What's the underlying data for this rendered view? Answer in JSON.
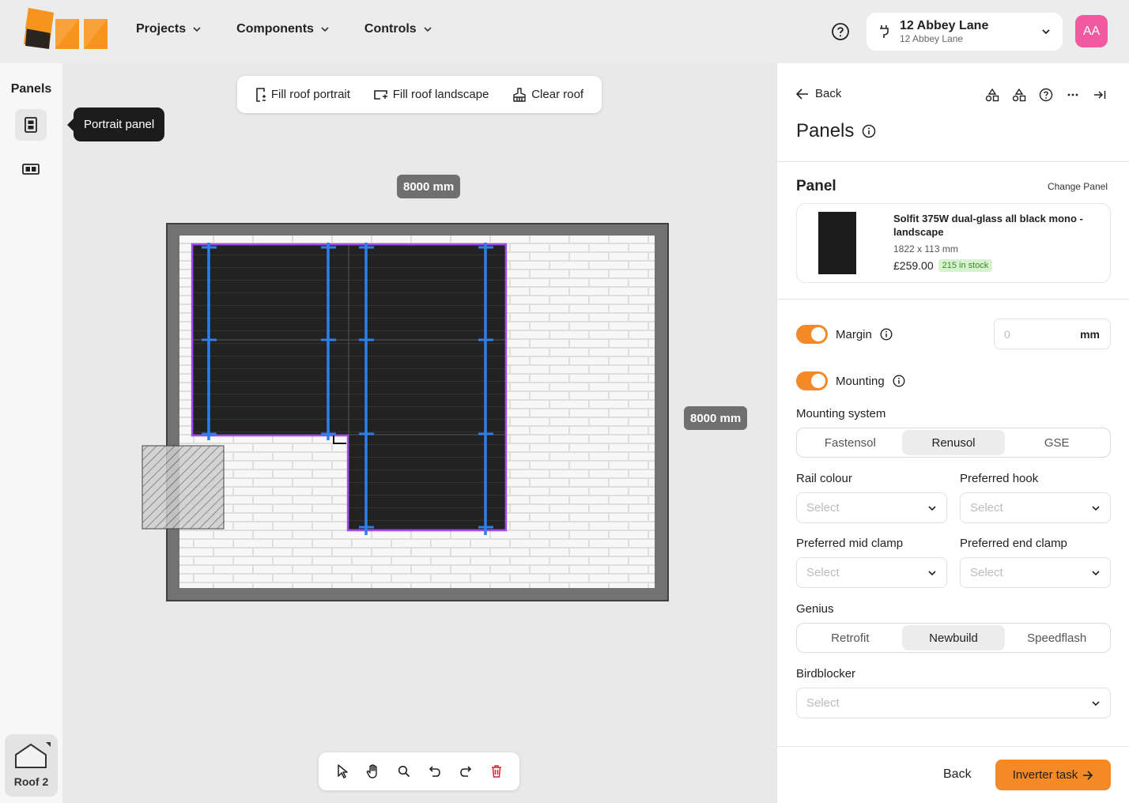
{
  "header": {
    "nav": [
      {
        "label": "Projects"
      },
      {
        "label": "Components"
      },
      {
        "label": "Controls"
      }
    ],
    "address": {
      "title": "12 Abbey Lane",
      "subtitle": "12 Abbey Lane"
    },
    "avatar_initials": "AA"
  },
  "left_rail": {
    "title": "Panels",
    "tooltip": "Portrait panel",
    "roof_label": "Roof 2"
  },
  "canvas": {
    "fill_actions": [
      {
        "label": "Fill roof portrait",
        "icon": "portrait-fill-icon"
      },
      {
        "label": "Fill roof landscape",
        "icon": "landscape-fill-icon"
      },
      {
        "label": "Clear roof",
        "icon": "brush-icon"
      }
    ],
    "width_label": "8000 mm",
    "height_label": "8000 mm",
    "tools": [
      "pointer-icon",
      "hand-icon",
      "zoom-icon",
      "undo-icon",
      "redo-icon",
      "trash-icon"
    ],
    "colors": {
      "panel_outline": "#a24cf0",
      "rail": "#2f7fe8",
      "roof_border": "#6b6b6b",
      "tiles": "#d9d9d9"
    }
  },
  "right_panel": {
    "back_label": "Back",
    "title": "Panels",
    "panel_section": {
      "heading": "Panel",
      "change_label": "Change Panel",
      "name": "Solfit 375W dual-glass all black mono - landscape",
      "size": "1822 x 113 mm",
      "price": "£259.00",
      "stock": "215 in stock"
    },
    "margin": {
      "label": "Margin",
      "enabled": true,
      "value": "0",
      "unit": "mm"
    },
    "mounting": {
      "label": "Mounting",
      "enabled": true
    },
    "mounting_system": {
      "label": "Mounting system",
      "options": [
        "Fastensol",
        "Renusol",
        "GSE"
      ],
      "selected": "Renusol"
    },
    "rail_colour": {
      "label": "Rail colour",
      "placeholder": "Select"
    },
    "preferred_hook": {
      "label": "Preferred hook",
      "placeholder": "Select"
    },
    "preferred_mid_clamp": {
      "label": "Preferred mid clamp",
      "placeholder": "Select"
    },
    "preferred_end_clamp": {
      "label": "Preferred end clamp",
      "placeholder": "Select"
    },
    "genius": {
      "label": "Genius",
      "options": [
        "Retrofit",
        "Newbuild",
        "Speedflash"
      ],
      "selected": "Newbuild"
    },
    "birdblocker": {
      "label": "Birdblocker",
      "placeholder": "Select"
    },
    "footer": {
      "back_label": "Back",
      "next_label": "Inverter task"
    },
    "accent_color": "#f38a26"
  }
}
